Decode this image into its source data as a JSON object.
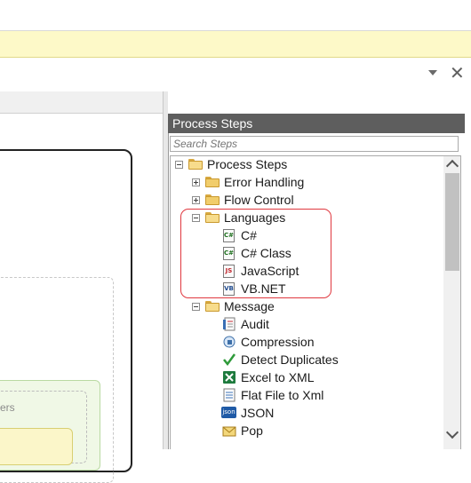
{
  "panel": {
    "title": "Process Steps",
    "search_placeholder": "Search Steps"
  },
  "tree": {
    "root": "Process Steps",
    "error_handling": "Error Handling",
    "flow_control": "Flow Control",
    "languages": {
      "label": "Languages",
      "items": [
        "C#",
        "C# Class",
        "JavaScript",
        "VB.NET"
      ]
    },
    "message": {
      "label": "Message",
      "items": [
        "Audit",
        "Compression",
        "Detect Duplicates",
        "Excel to XML",
        "Flat File to Xml",
        "JSON",
        "Pop"
      ]
    }
  },
  "canvas": {
    "partial_label": "ers"
  },
  "icons": {
    "panel_menu": "dropdown-arrow-icon",
    "panel_close": "close-icon",
    "cs_file": "csharp-file-icon",
    "js_file": "javascript-file-icon",
    "vb_file": "vbnet-file-icon",
    "audit": "audit-icon",
    "compression": "compression-icon",
    "detect_duplicates": "checkmark-icon",
    "excel": "excel-icon",
    "flat_file": "flat-file-icon",
    "json": "json-icon",
    "pop": "pop-icon"
  },
  "icon_text": {
    "cs": "C#",
    "js": "JS",
    "vb": "VB",
    "json": "json"
  },
  "colors": {
    "panel_header_bg": "#5e5e5e",
    "highlight": "#e0383f",
    "info_bar": "#fdf9c8"
  }
}
